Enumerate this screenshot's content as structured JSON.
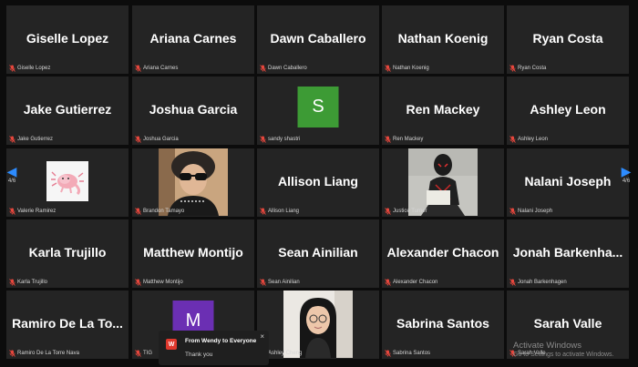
{
  "tiles": [
    {
      "name": "giselle-lopez",
      "display": "Giselle Lopez",
      "label": "Giselle Lopez"
    },
    {
      "name": "ariana-carnes",
      "display": "Ariana Carnes",
      "label": "Ariana Carnes"
    },
    {
      "name": "dawn-caballero",
      "display": "Dawn Caballero",
      "label": "Dawn Caballero"
    },
    {
      "name": "nathan-koenig",
      "display": "Nathan Koenig",
      "label": "Nathan Koenig"
    },
    {
      "name": "ryan-costa",
      "display": "Ryan Costa",
      "label": "Ryan Costa"
    },
    {
      "name": "jake-gutierrez",
      "display": "Jake Gutierrez",
      "label": "Jake Gutierrez"
    },
    {
      "name": "joshua-garcia",
      "display": "Joshua Garcia",
      "label": "Joshua Garcia"
    },
    {
      "name": "sandy-shastri",
      "display": "",
      "label": "sandy shastri",
      "avatar": "S",
      "avatarColor": "#3d9b35"
    },
    {
      "name": "ren-mackey",
      "display": "Ren Mackey",
      "label": "Ren Mackey"
    },
    {
      "name": "ashley-leon",
      "display": "Ashley Leon",
      "label": "Ashley Leon"
    },
    {
      "name": "valerie-ramirez",
      "display": "",
      "label": "Valerie Ramirez",
      "video": "axolotl"
    },
    {
      "name": "brandon-tamayo",
      "display": "",
      "label": "Brandon Tamayo",
      "video": "person-sunglasses"
    },
    {
      "name": "allison-liang",
      "display": "Allison Liang",
      "label": "Allison Liang"
    },
    {
      "name": "justice-turner",
      "display": "",
      "label": "Justice Turner",
      "video": "spider-figure"
    },
    {
      "name": "nalani-joseph",
      "display": "Nalani Joseph",
      "label": "Nalani Joseph"
    },
    {
      "name": "karla-trujillo",
      "display": "Karla Trujillo",
      "label": "Karla Trujillo"
    },
    {
      "name": "matthew-montijo",
      "display": "Matthew Montijo",
      "label": "Matthew Montijo"
    },
    {
      "name": "sean-ainilian",
      "display": "Sean Ainilian",
      "label": "Sean Ainilian"
    },
    {
      "name": "alexander-chacon",
      "display": "Alexander Chacon",
      "label": "Alexander Chacon"
    },
    {
      "name": "jonah-barkenhagen",
      "display": "Jonah  Barkenha...",
      "label": "Jonah Barkenhagen"
    },
    {
      "name": "ramiro-de-la-torre-nava",
      "display": "Ramiro De La To...",
      "label": "Ramiro De La Torre Nava"
    },
    {
      "name": "tig",
      "display": "",
      "label": "TIG",
      "avatar": "M",
      "avatarColor": "#6b2fb3"
    },
    {
      "name": "ashley-cheng",
      "display": "",
      "label": "Ashley Cheng",
      "video": "person-long-hair"
    },
    {
      "name": "sabrina-santos",
      "display": "Sabrina Santos",
      "label": "Sabrina Santos"
    },
    {
      "name": "sarah-valle",
      "display": "Sarah Valle",
      "label": "Sarah Valle"
    }
  ],
  "pager": {
    "left": {
      "icon": "chevron-left-icon",
      "text": "4/6"
    },
    "right": {
      "icon": "chevron-right-icon",
      "text": "4/6"
    }
  },
  "chat": {
    "badge": "W",
    "from": "From Wendy to Everyone",
    "message": "Thank you",
    "close": "×"
  },
  "watermark": {
    "title": "Activate Windows",
    "subtitle": "Go to Settings to activate Windows."
  },
  "colors": {
    "mute_icon": "#e8473d",
    "accent": "#2d8cff",
    "tile_bg": "#242424"
  }
}
